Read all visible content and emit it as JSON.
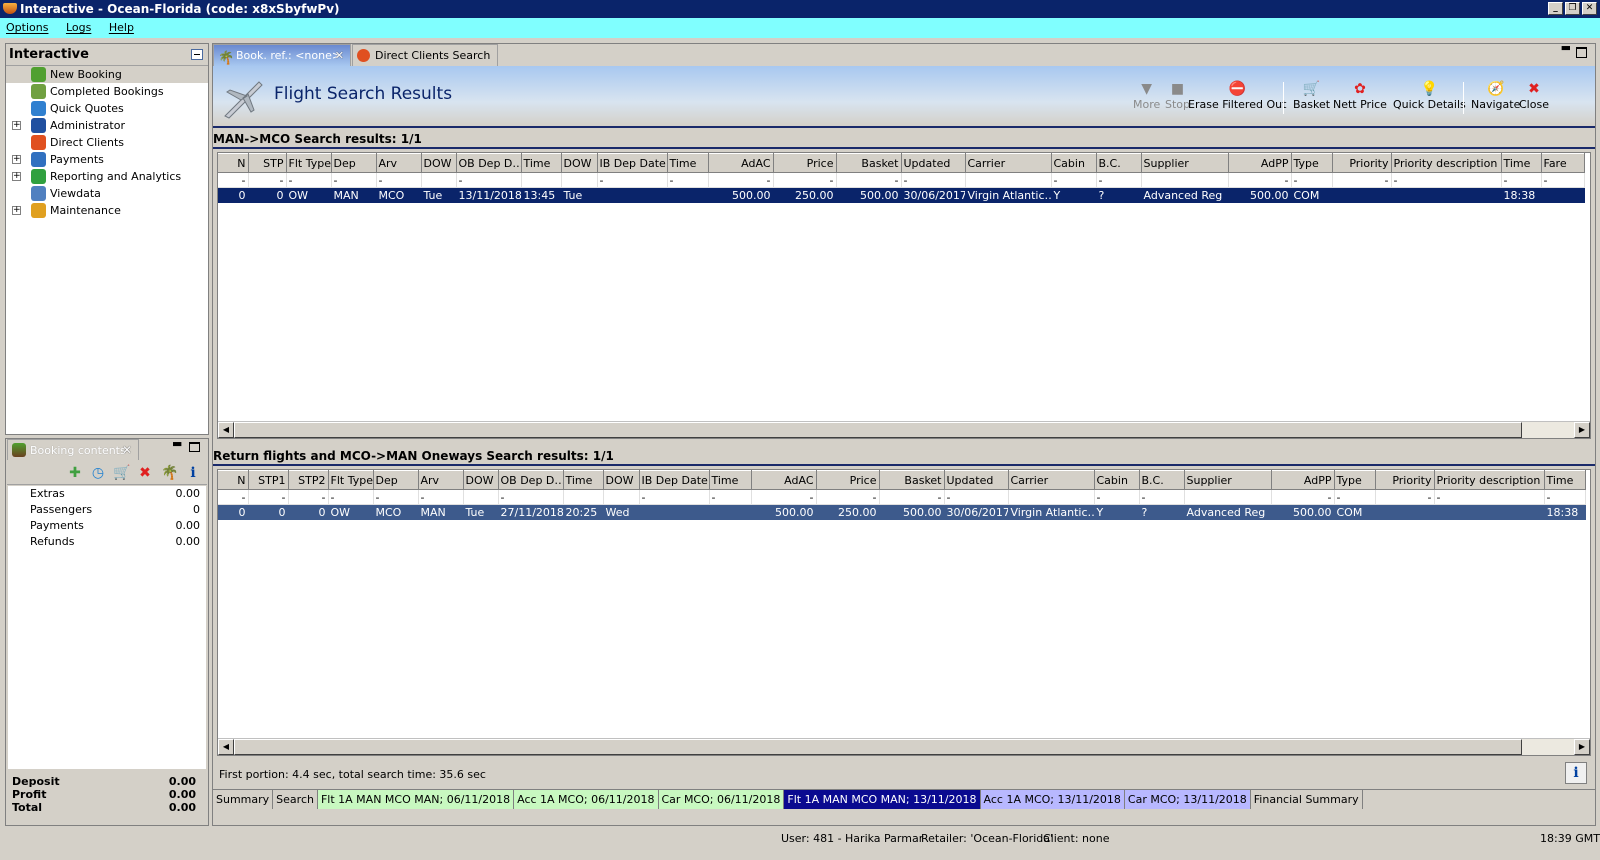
{
  "window": {
    "title": "Interactive - Ocean-Florida (code: x8xSbyfwPv)"
  },
  "menu": [
    "Options",
    "Logs",
    "Help"
  ],
  "nav": {
    "title": "Interactive",
    "items": [
      {
        "label": "New Booking",
        "expandable": false,
        "color": "#50a030"
      },
      {
        "label": "Completed Bookings",
        "expandable": false,
        "color": "#70a040"
      },
      {
        "label": "Quick Quotes",
        "expandable": false,
        "color": "#3080d0"
      },
      {
        "label": "Administrator",
        "expandable": true,
        "color": "#2050a0"
      },
      {
        "label": "Direct Clients",
        "expandable": false,
        "color": "#e05020"
      },
      {
        "label": "Payments",
        "expandable": true,
        "color": "#3070c0"
      },
      {
        "label": "Reporting and Analytics",
        "expandable": true,
        "color": "#30a040"
      },
      {
        "label": "Viewdata",
        "expandable": false,
        "color": "#5080c0"
      },
      {
        "label": "Maintenance",
        "expandable": true,
        "color": "#e0a020"
      }
    ]
  },
  "booking_contents": {
    "tab_label": "Booking contents",
    "rows": [
      {
        "label": "Extras",
        "value": "0.00"
      },
      {
        "label": "Passengers",
        "value": "0"
      },
      {
        "label": "Payments",
        "value": "0.00"
      },
      {
        "label": "Refunds",
        "value": "0.00"
      }
    ],
    "totals": [
      {
        "label": "Deposit",
        "value": "0.00"
      },
      {
        "label": "Profit",
        "value": "0.00"
      },
      {
        "label": "Total",
        "value": "0.00"
      }
    ]
  },
  "main": {
    "tabs": [
      {
        "label": "Book. ref.: <none>"
      },
      {
        "label": "Direct Clients Search"
      }
    ],
    "title": "Flight Search Results",
    "toolbar": [
      {
        "label": "More",
        "icon": "▼",
        "disabled": true
      },
      {
        "label": "Stop",
        "icon": "■",
        "disabled": true
      },
      {
        "label": "Erase Filtered Out",
        "icon": "⛔",
        "disabled": false
      },
      {
        "label": "Basket",
        "icon": "🛒",
        "disabled": false
      },
      {
        "label": "Nett Price",
        "icon": "✿",
        "disabled": false
      },
      {
        "label": "Quick Details",
        "icon": "💡",
        "disabled": false
      },
      {
        "label": "Navigate",
        "icon": "🧭",
        "disabled": false
      },
      {
        "label": "Close",
        "icon": "✖",
        "disabled": false
      }
    ],
    "outbound": {
      "heading": "MAN->MCO Search results: 1/1",
      "columns": [
        "N",
        "STP",
        "Flt Type",
        "Dep",
        "Arv",
        "DOW",
        "OB Dep D…",
        "Time",
        "DOW",
        "IB Dep Date",
        "Time",
        "AdAC",
        "Price",
        "Basket",
        "Updated",
        "Carrier",
        "Cabin",
        "B.C.",
        "Supplier",
        "AdPP",
        "Type",
        "Priority",
        "Priority description",
        "Time",
        "Fare"
      ],
      "filter": [
        "-",
        "-",
        "-",
        "-",
        "-",
        "",
        "-",
        "",
        "",
        "-",
        "-",
        "-",
        "-",
        "-",
        "-",
        "",
        "-",
        "-",
        "",
        "-",
        "-",
        "-",
        "-",
        "-",
        "-"
      ],
      "rows": [
        [
          "0",
          "0",
          "OW",
          "MAN",
          "MCO",
          "Tue",
          "13/11/2018",
          "13:45",
          "Tue",
          "",
          "",
          "500.00",
          "250.00",
          "500.00",
          "30/06/2017",
          "Virgin Atlantic…",
          "Y",
          "?",
          "Advanced Reg",
          "500.00",
          "COM",
          "",
          "",
          "18:38",
          ""
        ]
      ]
    },
    "return": {
      "heading": "Return flights and MCO->MAN Oneways Search results: 1/1",
      "columns": [
        "N",
        "STP1",
        "STP2",
        "Flt Type",
        "Dep",
        "Arv",
        "DOW",
        "OB Dep D…",
        "Time",
        "DOW",
        "IB Dep Date",
        "Time",
        "AdAC",
        "Price",
        "Basket",
        "Updated",
        "Carrier",
        "Cabin",
        "B.C.",
        "Supplier",
        "AdPP",
        "Type",
        "Priority",
        "Priority description",
        "Time"
      ],
      "filter": [
        "-",
        "-",
        "-",
        "-",
        "-",
        "-",
        "",
        "-",
        "",
        "",
        "-",
        "-",
        "-",
        "-",
        "-",
        "-",
        "",
        "-",
        "-",
        "",
        "-",
        "-",
        "-",
        "-",
        "-"
      ],
      "rows": [
        [
          "0",
          "0",
          "0",
          "OW",
          "MCO",
          "MAN",
          "Tue",
          "27/11/2018",
          "20:25",
          "Wed",
          "",
          "",
          "500.00",
          "250.00",
          "500.00",
          "30/06/2017",
          "Virgin Atlantic…",
          "Y",
          "?",
          "Advanced Reg",
          "500.00",
          "COM",
          "",
          "",
          "18:38"
        ]
      ]
    },
    "timing": "First portion: 4.4 sec, total search time: 35.6 sec",
    "bottom_tabs": [
      {
        "label": "Summary",
        "bg": "#d4d0c8",
        "fg": "#000"
      },
      {
        "label": "Search",
        "bg": "#d4d0c8",
        "fg": "#000"
      },
      {
        "label": "Flt 1A MAN MCO MAN; 06/11/2018",
        "bg": "#c8f8c0",
        "fg": "#000"
      },
      {
        "label": "Acc 1A MCO; 06/11/2018",
        "bg": "#c8f8c0",
        "fg": "#000"
      },
      {
        "label": "Car MCO; 06/11/2018",
        "bg": "#c8f8c0",
        "fg": "#000"
      },
      {
        "label": "Flt 1A MAN MCO MAN; 13/11/2018",
        "bg": "#0a0a90",
        "fg": "#fff"
      },
      {
        "label": "Acc 1A MCO; 13/11/2018",
        "bg": "#b8b8ff",
        "fg": "#000"
      },
      {
        "label": "Car MCO; 13/11/2018",
        "bg": "#b8b8ff",
        "fg": "#000"
      },
      {
        "label": "Financial Summary",
        "bg": "#d4d0c8",
        "fg": "#000"
      }
    ]
  },
  "status": {
    "user": "User: 481 - Harika Parmar",
    "retailer": "Retailer: 'Ocean-Florida'",
    "client": "Client: none",
    "time": "18:39 GMT"
  }
}
